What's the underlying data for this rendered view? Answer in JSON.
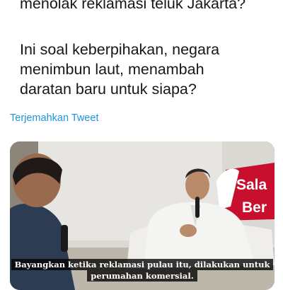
{
  "tweet": {
    "line_partial": "menolak reklamasi teluk Jakarta?",
    "lines": [
      "Ini soal keberpihakan, negara",
      "menimbun laut, menambah",
      "daratan baru untuk siapa?"
    ],
    "translate_link": "Terjemahkan Tweet"
  },
  "video": {
    "banner_text": [
      "Sala",
      "Ber"
    ],
    "subtitle_lines": [
      "Bayangkan ketika reklamasi pulau itu, dilakukan untuk",
      "perumahan komersial."
    ]
  },
  "colors": {
    "text": "#14171a",
    "link": "#1b95e0",
    "banner_red": "#c8102e"
  }
}
